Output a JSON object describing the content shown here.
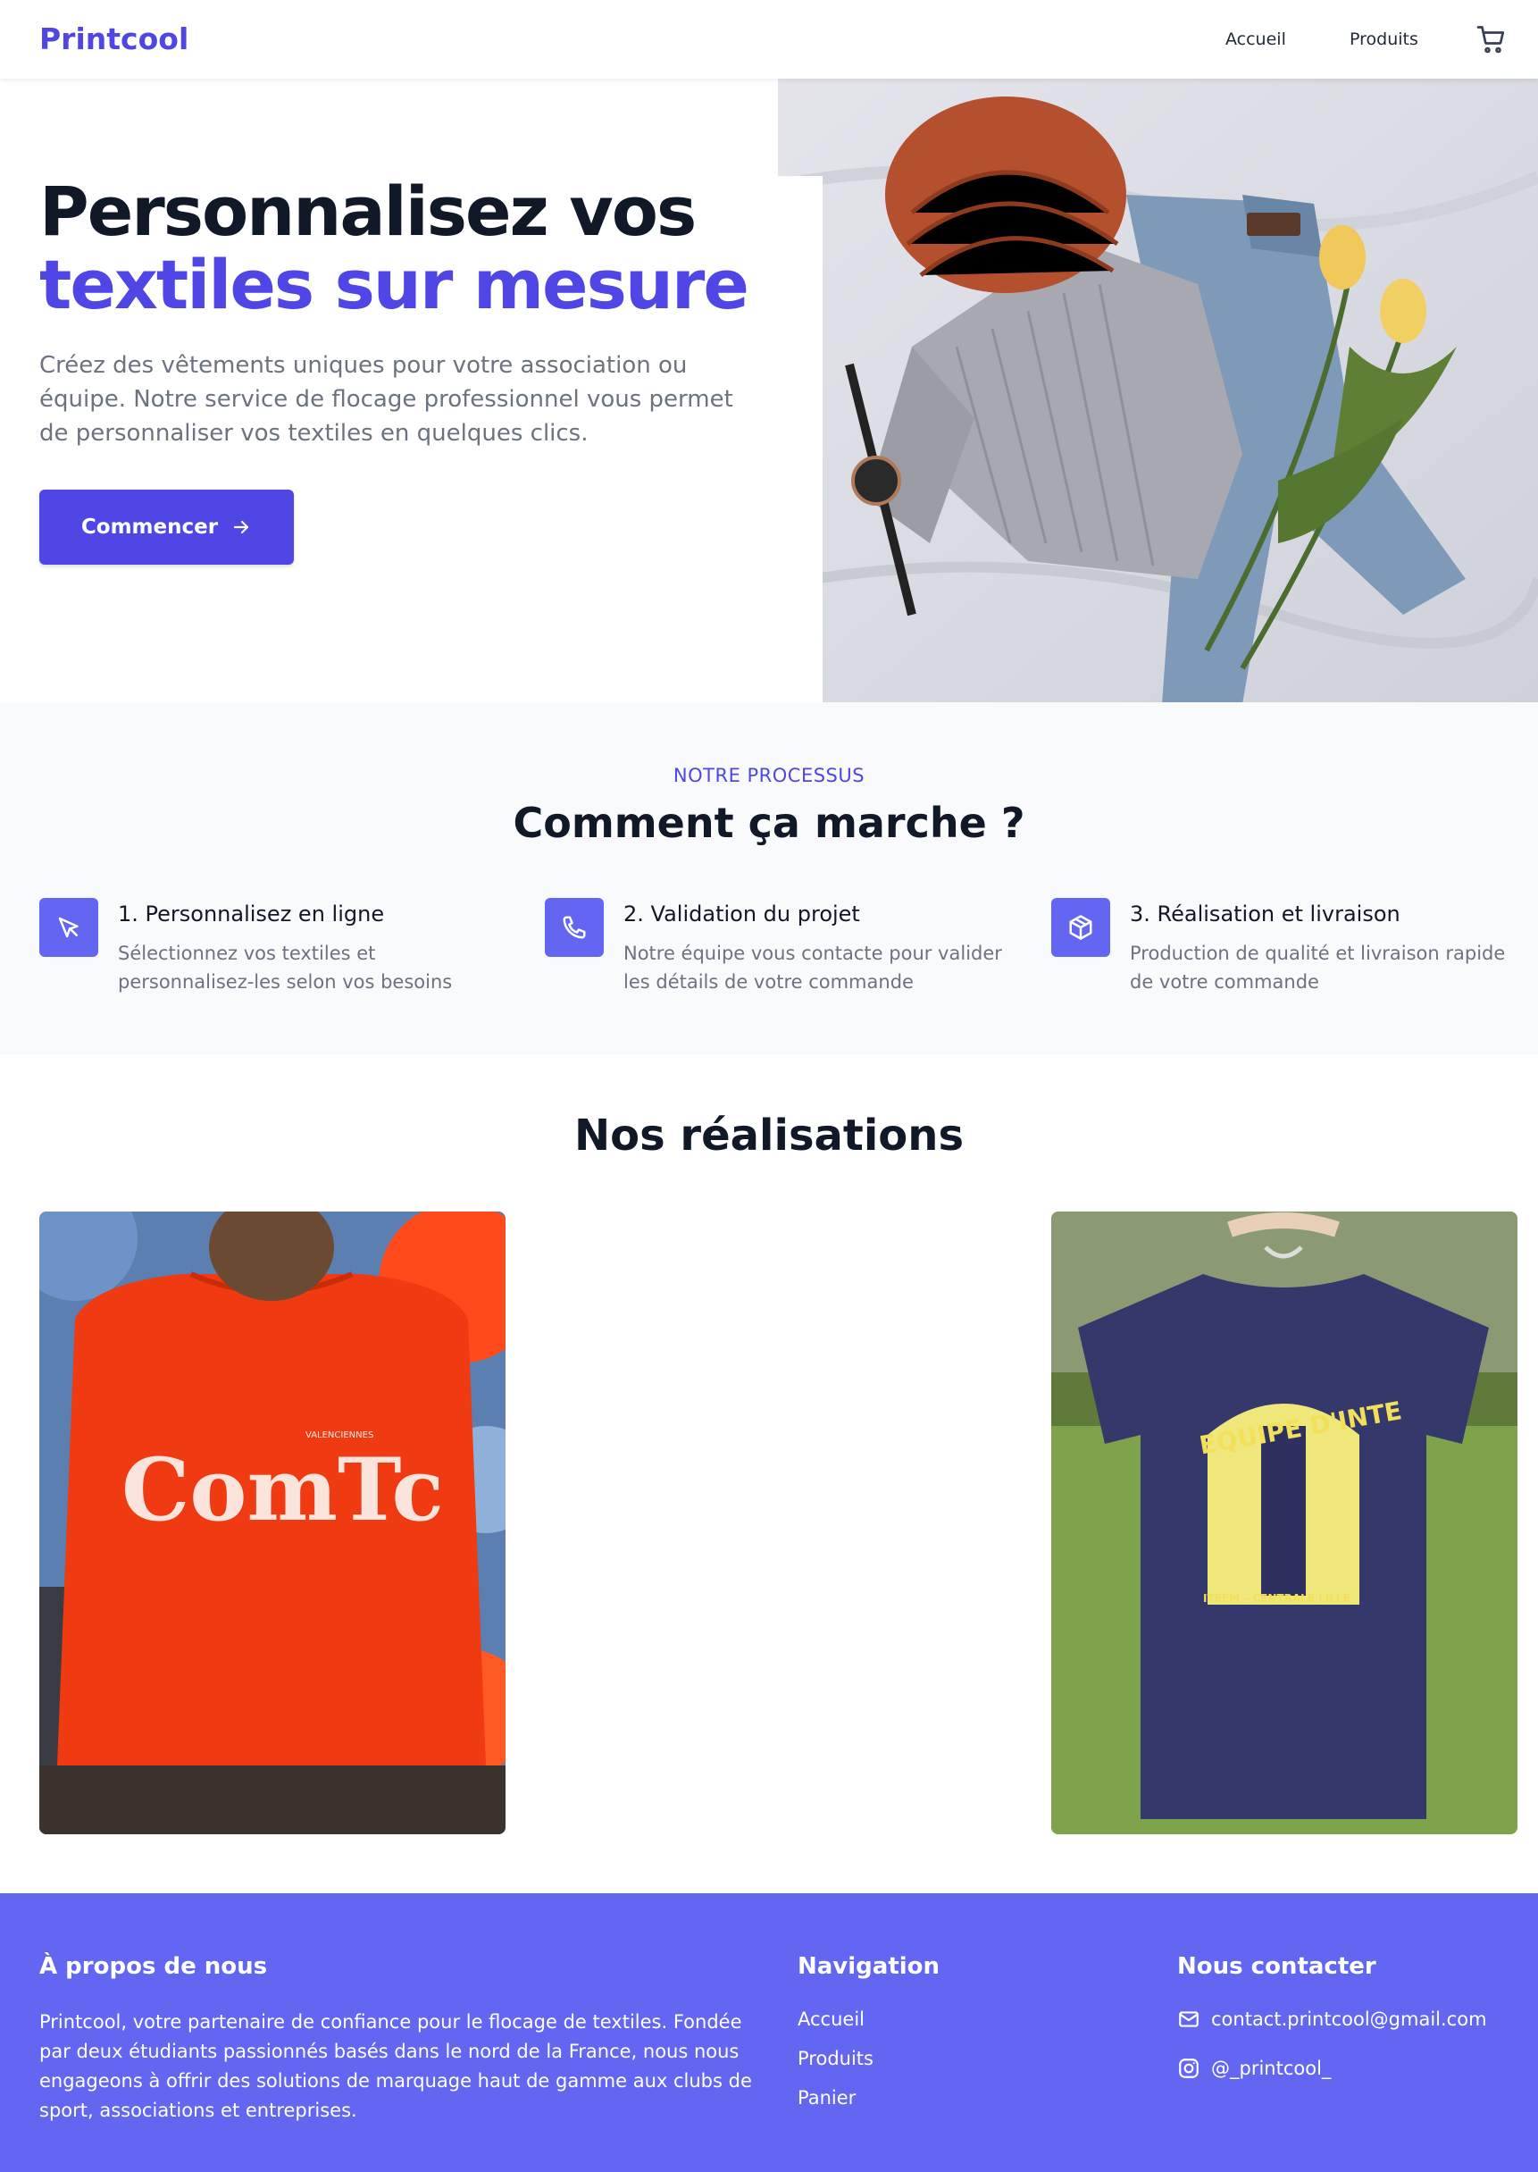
{
  "header": {
    "logo": "Printcool",
    "nav": [
      {
        "label": "Accueil"
      },
      {
        "label": "Produits"
      }
    ],
    "cart_icon": "cart-icon"
  },
  "hero": {
    "title_line1": "Personnalisez vos",
    "title_line2": "textiles sur mesure",
    "description": "Créez des vêtements uniques pour votre association ou équipe. Notre service de flocage professionnel vous permet de personnaliser vos textiles en quelques clics.",
    "cta_label": "Commencer",
    "cta_icon": "arrow-right-icon"
  },
  "process": {
    "eyebrow": "NOTRE PROCESSUS",
    "title": "Comment ça marche ?",
    "steps": [
      {
        "icon": "cursor-pointer-icon",
        "title": "1. Personnalisez en ligne",
        "description": "Sélectionnez vos textiles et personnalisez-les selon vos besoins"
      },
      {
        "icon": "phone-icon",
        "title": "2. Validation du projet",
        "description": "Notre équipe vous contacte pour valider les détails de votre commande"
      },
      {
        "icon": "package-icon",
        "title": "3. Réalisation et livraison",
        "description": "Production de qualité et livraison rapide de votre commande"
      }
    ]
  },
  "realisations": {
    "title": "Nos réalisations",
    "photos": [
      {
        "print_top": "VALENCIENNES",
        "print_main": "ComTc"
      },
      {
        "print_top": "EQUIPE D'INTE",
        "print_bottom": "ITEEM – CENTRALE LILLE"
      }
    ]
  },
  "footer": {
    "about_title": "À propos de nous",
    "about_text": "Printcool, votre partenaire de confiance pour le flocage de textiles. Fondée par deux étudiants passionnés basés dans le nord de la France, nous nous engageons à offrir des solutions de marquage haut de gamme aux clubs de sport, associations et entreprises.",
    "nav_title": "Navigation",
    "nav_links": [
      {
        "label": "Accueil"
      },
      {
        "label": "Produits"
      },
      {
        "label": "Panier"
      }
    ],
    "contact_title": "Nous contacter",
    "email": "contact.printcool@gmail.com",
    "email_icon": "mail-icon",
    "instagram": "@_printcool_",
    "instagram_icon": "instagram-icon"
  },
  "colors": {
    "accent": "#4f46e5",
    "footer_bg": "#6366f1",
    "section_bg": "#f9fafb"
  }
}
